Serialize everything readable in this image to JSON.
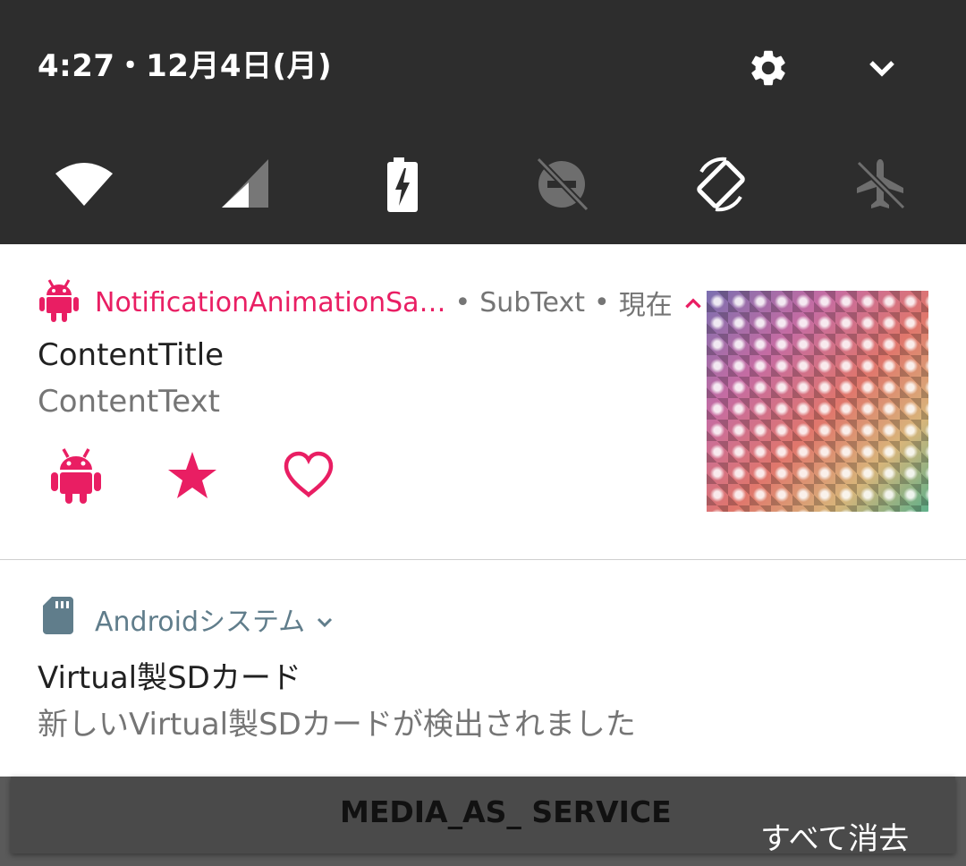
{
  "quick_settings": {
    "datetime": "4:27・12月4日(月)",
    "icons": {
      "settings": "gear-icon",
      "expand": "chevron-down-icon",
      "tiles": [
        "wifi-icon",
        "cellular-signal-icon",
        "battery-charging-icon",
        "do-not-disturb-off-icon",
        "auto-rotate-icon",
        "airplane-mode-off-icon"
      ]
    }
  },
  "notifications": [
    {
      "app_name": "NotificationAnimationSa…",
      "separator": "•",
      "sub_text": "SubText",
      "time": "現在",
      "title": "ContentTitle",
      "text": "ContentText",
      "accent_color": "#e91e63",
      "actions": [
        "android-icon",
        "star-icon",
        "heart-outline-icon"
      ]
    },
    {
      "app_name": "Androidシステム",
      "title": "Virtual製SDカード",
      "text": "新しいVirtual製SDカードが検出されました",
      "accent_color": "#607d8b",
      "icon": "sd-card-icon"
    }
  ],
  "bottom": {
    "media_label": "MEDIA_AS_ SERVICE",
    "clear_all": "すべて消去"
  }
}
